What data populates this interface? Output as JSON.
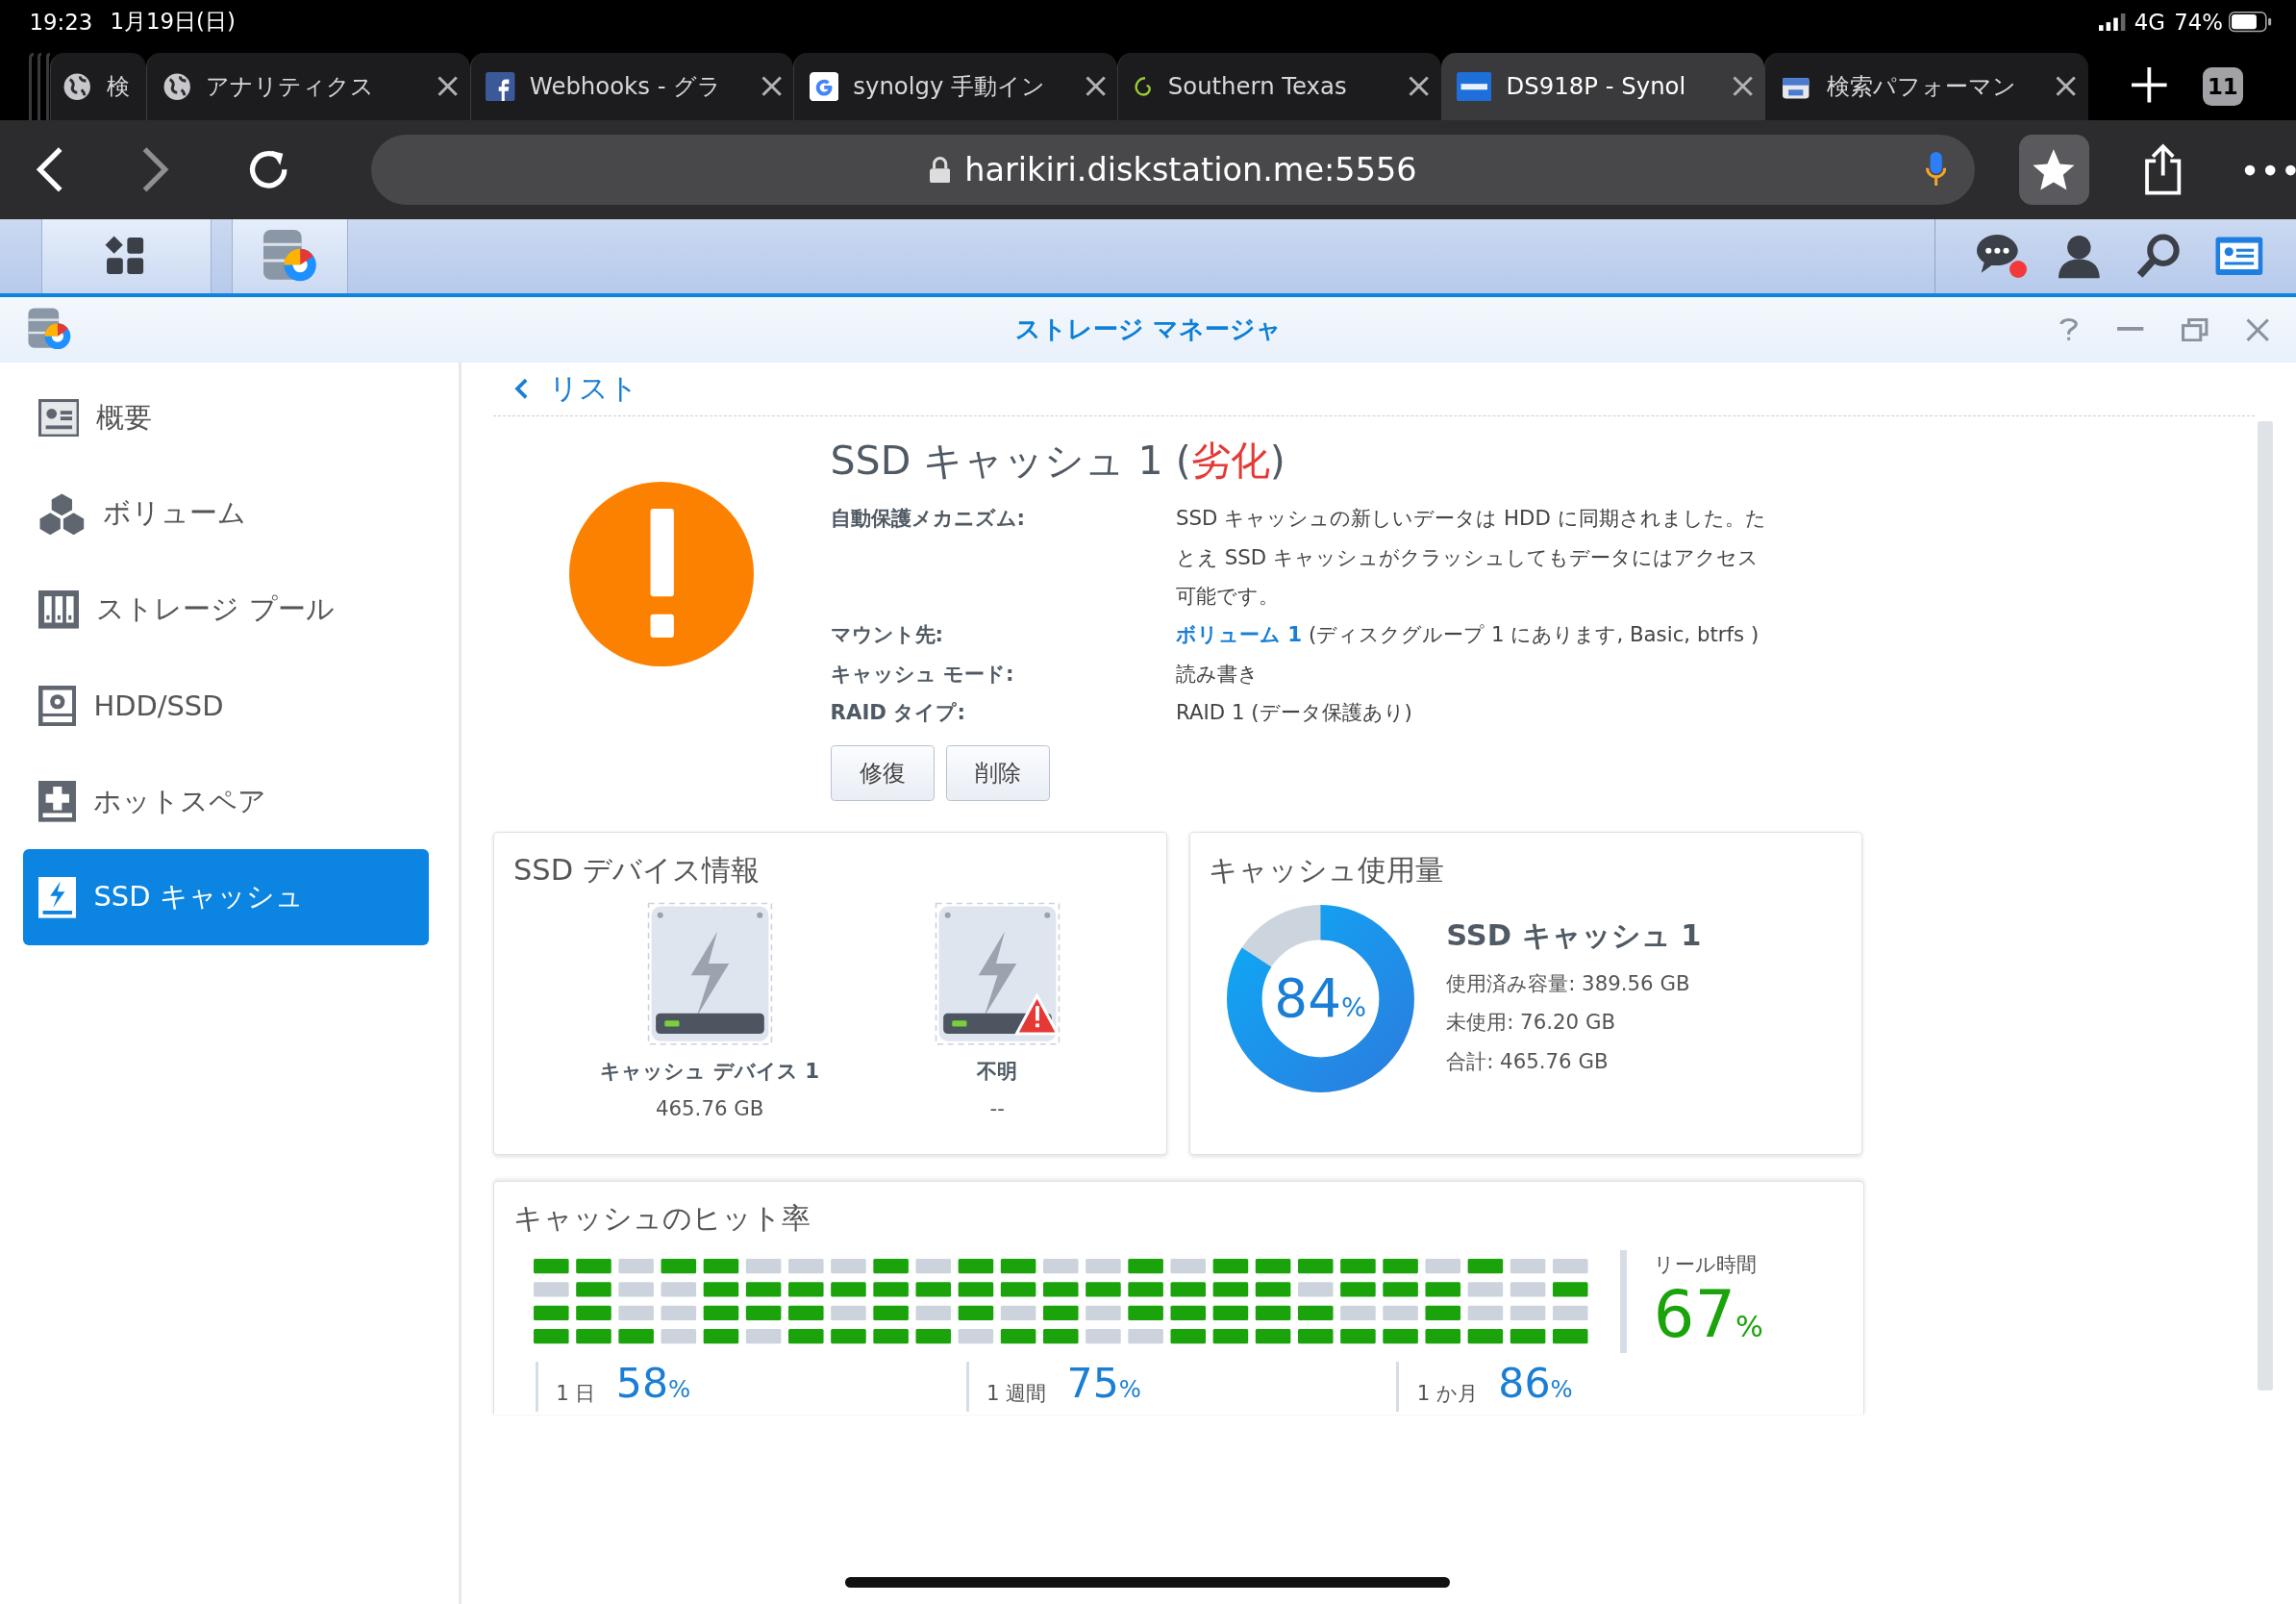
{
  "status_bar": {
    "time": "19:23",
    "date": "1月19日(日)",
    "network": "4G",
    "battery": "74%"
  },
  "browser_tabs": [
    {
      "title": "検",
      "kind": "globe",
      "closable": false,
      "selected": false
    },
    {
      "title": "アナリティクス",
      "kind": "globe",
      "closable": true,
      "selected": false
    },
    {
      "title": "Webhooks - グラ",
      "kind": "facebook",
      "closable": true,
      "selected": false
    },
    {
      "title": "synolgy 手動イン",
      "kind": "google",
      "closable": true,
      "selected": false
    },
    {
      "title": "Southern Texas",
      "kind": "spiral",
      "closable": true,
      "selected": false
    },
    {
      "title": "DS918P - Synol",
      "kind": "dsm",
      "closable": true,
      "selected": true
    },
    {
      "title": "検索パフォーマン",
      "kind": "store",
      "closable": true,
      "selected": false
    }
  ],
  "tab_count": "11",
  "address_bar": {
    "url": "harikiri.diskstation.me:5556"
  },
  "taskbar": {
    "apps": [
      {
        "kind": "main-menu"
      },
      {
        "kind": "storage"
      }
    ],
    "notification": true
  },
  "window": {
    "title": "ストレージ マネージャ"
  },
  "sidebar": {
    "items": [
      {
        "label": "概要",
        "kind": "overview",
        "selected": false
      },
      {
        "label": "ボリューム",
        "kind": "volume",
        "selected": false
      },
      {
        "label": "ストレージ プール",
        "kind": "pool",
        "selected": false
      },
      {
        "label": "HDD/SSD",
        "kind": "disk",
        "selected": false
      },
      {
        "label": "ホットスペア",
        "kind": "spare",
        "selected": false
      },
      {
        "label": "SSD キャッシュ",
        "kind": "cache",
        "selected": true
      }
    ]
  },
  "back_link": "リスト",
  "cache": {
    "name": "SSD キャッシュ 1 (",
    "status": "劣化",
    "name_end": ")",
    "details": [
      {
        "label": "自動保護メカニズム:",
        "value": "SSD キャッシュの新しいデータは HDD に同期されました。たとえ SSD キャッシュがクラッシュしてもデータにはアクセス可能です。"
      },
      {
        "label": "マウント先:",
        "link": "ボリューム 1",
        "value": "(ディスクグループ 1 にあります, Basic, btrfs )"
      },
      {
        "label": "キャッシュ モード:",
        "value": "読み書き"
      },
      {
        "label": "RAID タイプ:",
        "value": "RAID 1 (データ保護あり)"
      }
    ],
    "buttons": [
      "修復",
      "削除"
    ]
  },
  "devices": {
    "title": "SSD デバイス情報",
    "items": [
      {
        "name": "キャッシュ デバイス 1",
        "size": "465.76 GB",
        "warning": false
      },
      {
        "name": "不明",
        "size": "--",
        "warning": true
      }
    ]
  },
  "usage": {
    "title": "キャッシュ使用量",
    "level": 0.84,
    "percent": "84",
    "unit": "%",
    "name": "SSD キャッシュ 1",
    "lines": [
      "使用済み容量: 389.56 GB",
      "未使用: 76.20 GB",
      "合計: 465.76 GB"
    ]
  },
  "hit_rate": {
    "title": "キャッシュのヒット率",
    "rows": [
      [
        true,
        true,
        false,
        true,
        true,
        false,
        false,
        false,
        true,
        false,
        true,
        true,
        false,
        false,
        true,
        false,
        true,
        true,
        true,
        true,
        true,
        false,
        true,
        false,
        false
      ],
      [
        false,
        true,
        false,
        false,
        true,
        true,
        true,
        true,
        true,
        true,
        true,
        true,
        true,
        true,
        true,
        true,
        true,
        true,
        false,
        true,
        true,
        true,
        false,
        false,
        true
      ],
      [
        true,
        true,
        false,
        false,
        true,
        true,
        true,
        false,
        true,
        false,
        true,
        false,
        true,
        false,
        true,
        true,
        true,
        true,
        true,
        false,
        false,
        true,
        false,
        false,
        false
      ],
      [
        true,
        true,
        true,
        false,
        true,
        false,
        true,
        true,
        true,
        true,
        false,
        true,
        true,
        false,
        false,
        true,
        true,
        true,
        true,
        true,
        true,
        true,
        true,
        true,
        true
      ]
    ],
    "realtime_label": "リール時間",
    "realtime_value": "67",
    "realtime_unit": "%",
    "periods": [
      {
        "label": "1 日",
        "value": "58",
        "unit": "%"
      },
      {
        "label": "1 週間",
        "value": "75",
        "unit": "%"
      },
      {
        "label": "1 か月",
        "value": "86",
        "unit": "%"
      }
    ]
  }
}
